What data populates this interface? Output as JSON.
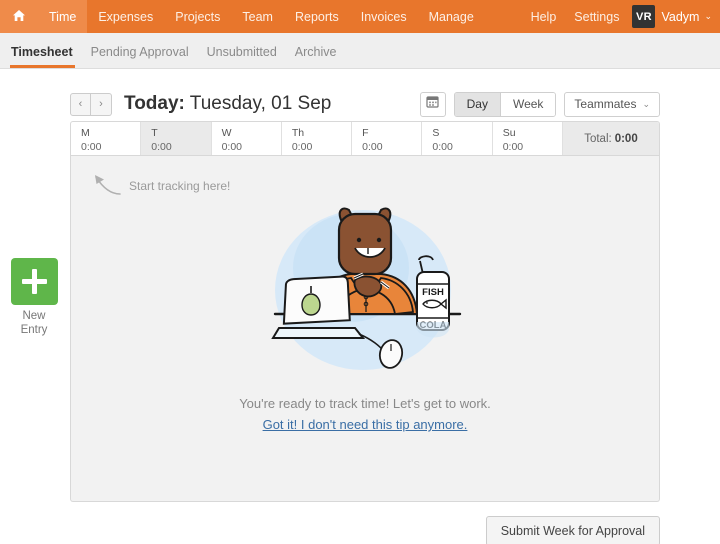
{
  "topnav": {
    "home_icon": "home-icon",
    "items": [
      {
        "label": "Time",
        "active": true
      },
      {
        "label": "Expenses",
        "active": false
      },
      {
        "label": "Projects",
        "active": false
      },
      {
        "label": "Team",
        "active": false
      },
      {
        "label": "Reports",
        "active": false
      },
      {
        "label": "Invoices",
        "active": false
      },
      {
        "label": "Manage",
        "active": false
      }
    ],
    "right_items": [
      {
        "label": "Help"
      },
      {
        "label": "Settings"
      }
    ],
    "avatar_initials": "VR",
    "user_name": "Vadym",
    "user_caret": "⌄",
    "bg_color": "#e8762c",
    "active_bg_color": "#ef8b4a"
  },
  "subnav": {
    "tabs": [
      {
        "label": "Timesheet",
        "active": true
      },
      {
        "label": "Pending Approval",
        "active": false
      },
      {
        "label": "Unsubmitted",
        "active": false
      },
      {
        "label": "Archive",
        "active": false
      }
    ],
    "accent_color": "#e8762c"
  },
  "toolbar": {
    "prev_label": "‹",
    "next_label": "›",
    "title_prefix": "Today:",
    "title_date": " Tuesday, 01 Sep",
    "calendar_icon": "calendar-icon",
    "view_day": "Day",
    "view_week": "Week",
    "view_active": "Day",
    "teammates_label": "Teammates",
    "teammates_caret": "⌄"
  },
  "week": {
    "days": [
      {
        "label": "M",
        "value": "0:00",
        "today": false
      },
      {
        "label": "T",
        "value": "0:00",
        "today": true
      },
      {
        "label": "W",
        "value": "0:00",
        "today": false
      },
      {
        "label": "Th",
        "value": "0:00",
        "today": false
      },
      {
        "label": "F",
        "value": "0:00",
        "today": false
      },
      {
        "label": "S",
        "value": "0:00",
        "today": false
      },
      {
        "label": "Su",
        "value": "0:00",
        "today": false
      }
    ],
    "total_label": "Total:",
    "total_value": "0:00"
  },
  "new_entry": {
    "icon": "plus-icon",
    "label_line1": "New",
    "label_line2": "Entry",
    "color": "#5fb64a"
  },
  "tip": {
    "arrow_icon": "curved-arrow-up-left-icon",
    "text": "Start tracking here!"
  },
  "illustration": {
    "name": "bear-at-desk-illustration",
    "bottle_label_line1": "FISH",
    "bottle_label_line2": "COLA",
    "bottle_icon": "fish-icon",
    "laptop_logo": "pear-logo-icon",
    "mouse_icon": "computer-mouse-icon",
    "colors": {
      "bear_fur": "#8a5232",
      "shirt": "#e8853a",
      "backdrop": "#cfe4f5",
      "laptop": "#ffffff",
      "pear": "#b9d48a"
    }
  },
  "empty_state": {
    "message": "You're ready to track time! Let's get to work.",
    "dismiss_link": "Got it! I don't need this tip anymore."
  },
  "footer": {
    "submit_label": "Submit Week for Approval"
  }
}
